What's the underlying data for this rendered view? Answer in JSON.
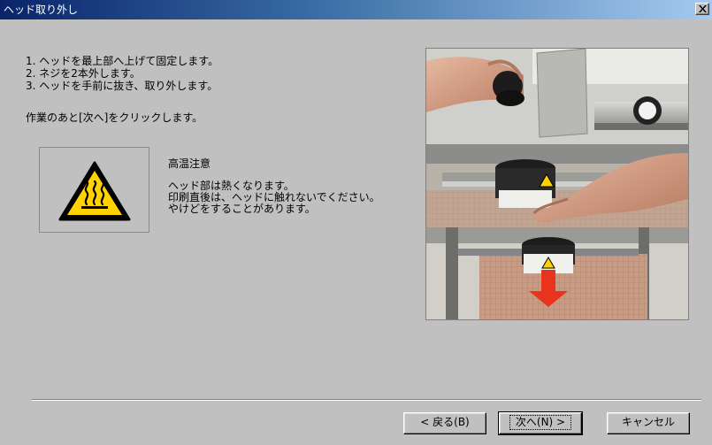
{
  "window": {
    "title": "ヘッド取り外し"
  },
  "steps": [
    "1. ヘッドを最上部へ上げて固定します。",
    "2. ネジを2本外します。",
    "3. ヘッドを手前に抜き、取り外します。"
  ],
  "instruction": "作業のあと[次へ]をクリックします。",
  "warning": {
    "icon": "hot-surface-warning-icon",
    "title": "高温注意",
    "lines": [
      "ヘッド部は熱くなります。",
      "印刷直後は、ヘッドに触れないでください。",
      "やけどをすることがあります。"
    ]
  },
  "photo": {
    "description_icon": "head-removal-photo",
    "arrow_color": "#e8341c"
  },
  "buttons": {
    "back": "< 戻る(B)",
    "next": "次へ(N) >",
    "cancel": "キャンセル"
  },
  "colors": {
    "titlebar_start": "#0a246a",
    "titlebar_end": "#a6caf0",
    "warning_yellow": "#ffd200"
  }
}
